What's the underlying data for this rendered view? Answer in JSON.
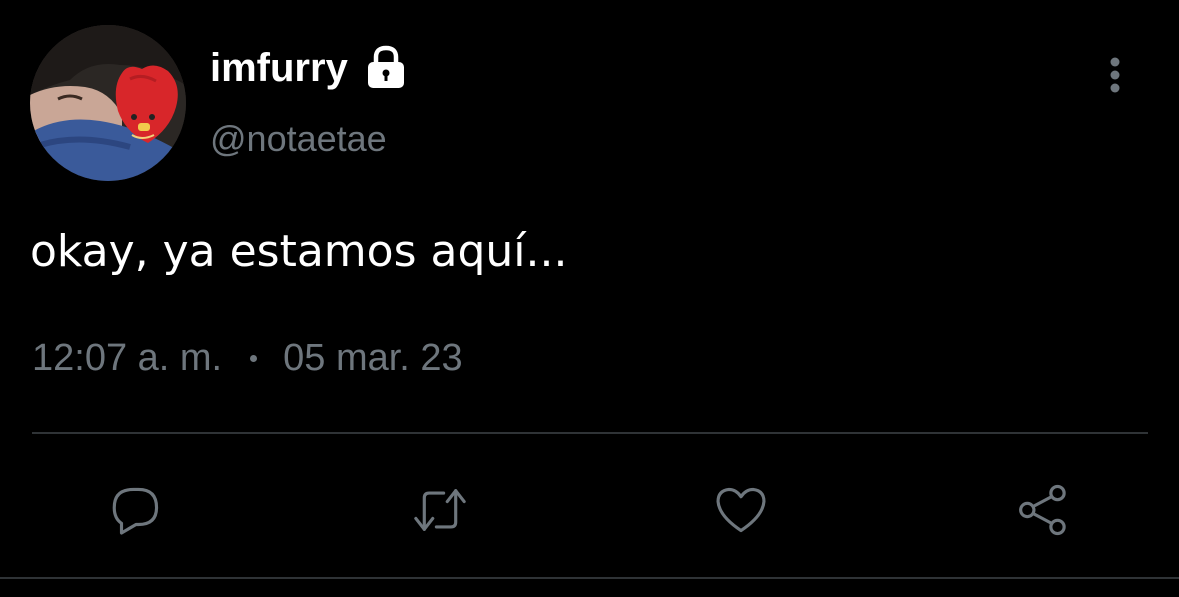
{
  "tweet": {
    "display_name": "imfurry",
    "handle": "@notaetae",
    "text": "okay, ya estamos aquí...",
    "time": "12:07 a. m.",
    "date": "05 mar. 23",
    "protected": true
  },
  "icons": {
    "lock": "lock-icon",
    "more": "more-vertical-icon",
    "reply": "reply-icon",
    "retweet": "retweet-icon",
    "like": "heart-icon",
    "share": "share-icon"
  },
  "colors": {
    "background": "#000000",
    "text": "#ffffff",
    "secondary": "#6e767d",
    "divider": "#2f3336"
  }
}
